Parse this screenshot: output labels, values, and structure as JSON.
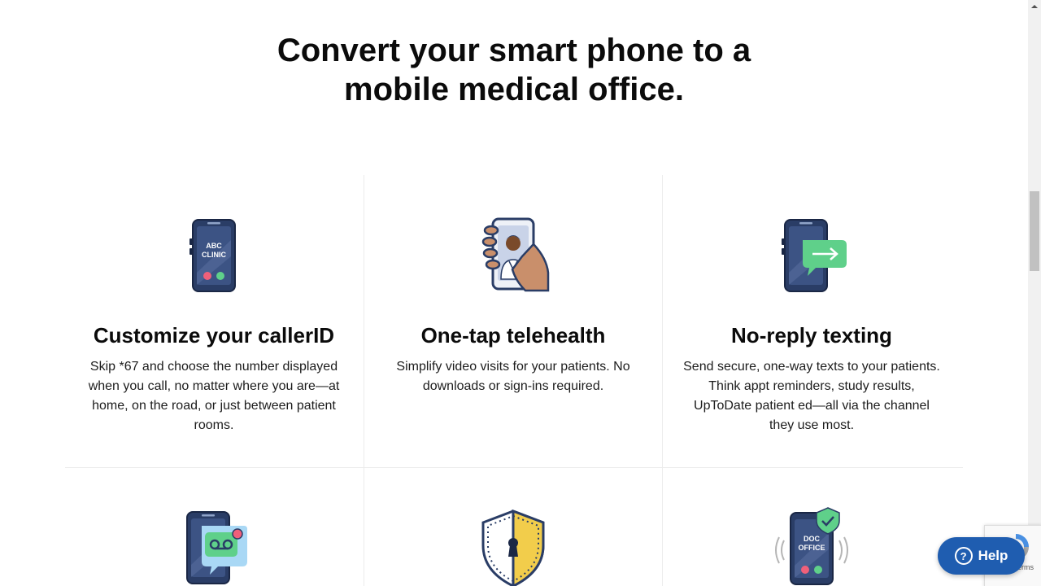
{
  "hero": {
    "title_line1": "Convert your smart phone to a",
    "title_line2": "mobile medical office."
  },
  "features": [
    {
      "icon": "caller-id-phone-icon",
      "icon_text_line1": "ABC",
      "icon_text_line2": "CLINIC",
      "title": "Customize your callerID",
      "description": "Skip *67 and choose the number displayed when you call, no matter where you are—at home, on the road, or just between patient rooms."
    },
    {
      "icon": "telehealth-phone-icon",
      "title": "One-tap telehealth",
      "description": "Simplify video visits for your patients. No downloads or sign-ins required."
    },
    {
      "icon": "texting-phone-icon",
      "title": "No-reply texting",
      "description": "Send secure, one-way texts to your patients. Think appt reminders, study results, UpToDate patient ed—all via the channel they use most."
    }
  ],
  "second_row_icons": [
    {
      "icon": "voicemail-phone-icon"
    },
    {
      "icon": "security-shield-icon"
    },
    {
      "icon": "doc-office-phone-icon",
      "icon_text_line1": "DOC",
      "icon_text_line2": "OFFICE"
    }
  ],
  "help_button": {
    "label": "Help",
    "icon": "question-circle-icon"
  },
  "recaptcha": {
    "terms_text": "erms"
  },
  "colors": {
    "phone_navy": "#2a3d66",
    "accent_green": "#5fd08a",
    "accent_red": "#f0607a",
    "shield_yellow": "#f2cd4b",
    "help_blue": "#1f5db0"
  }
}
